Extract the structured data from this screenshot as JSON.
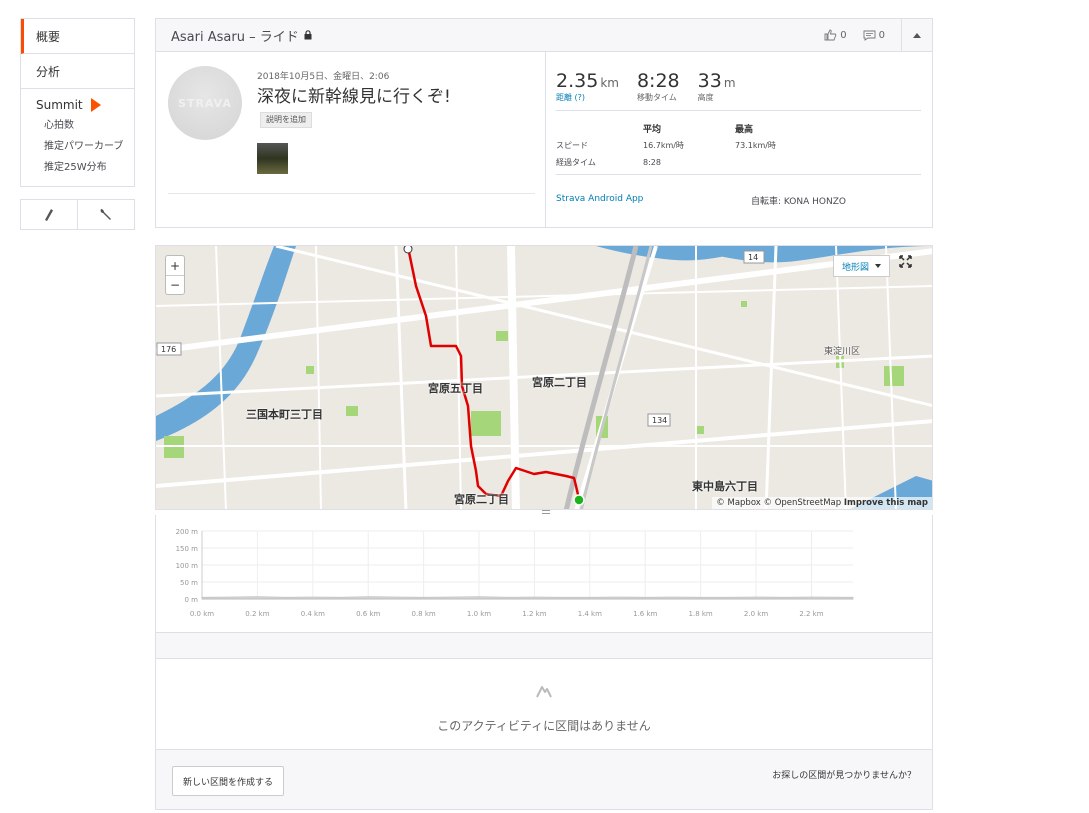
{
  "nav": {
    "overview": "概要",
    "analysis": "分析",
    "summit": "Summit",
    "sub_items": [
      "心拍数",
      "推定パワーカーブ",
      "推定25W分布"
    ]
  },
  "header": {
    "athlete_title": "Asari Asaru – ライド",
    "kudos_count": "0",
    "comment_count": "0"
  },
  "activity": {
    "avatar_text": "STRAVA",
    "date": "2018年10月5日、金曜日、2:06",
    "title": "深夜に新幹線見に行くぞ!",
    "add_description": "説明を追加"
  },
  "stats": {
    "distance": {
      "value": "2.35",
      "unit": "km",
      "label": "距離 (?)"
    },
    "moving_time": {
      "value": "8:28",
      "label": "移動タイム"
    },
    "elevation": {
      "value": "33",
      "unit": "m",
      "label": "高度"
    },
    "table_headers": {
      "avg": "平均",
      "max": "最高"
    },
    "speed": {
      "label": "スピード",
      "avg": "16.7km/時",
      "max": "73.1km/時"
    },
    "elapsed": {
      "label": "経過タイム",
      "avg": "8:28"
    },
    "device": "Strava Android App",
    "bike": "自転車: KONA HONZO"
  },
  "map": {
    "maptype": "地形図",
    "zoom_in": "+",
    "zoom_out": "−",
    "attribution_1": "© Mapbox © OpenStreetMap",
    "attribution_2": "Improve this map",
    "labels": {
      "miyahara5": "宮原五丁目",
      "miyahara2": "宮原二丁目",
      "mikuni": "三国本町三丁目",
      "higashinakajima": "東中島六丁目",
      "miyahara_bottom": "宮原二丁目",
      "higashiyodogawa": "東淀川区",
      "route14": "14",
      "route134": "134",
      "route176": "176"
    }
  },
  "elevation_chart": {
    "y_ticks": [
      "200 m",
      "150 m",
      "100 m",
      "50 m",
      "0 m"
    ],
    "x_ticks": [
      "0.0 km",
      "0.2 km",
      "0.4 km",
      "0.6 km",
      "0.8 km",
      "1.0 km",
      "1.2 km",
      "1.4 km",
      "1.6 km",
      "1.8 km",
      "2.0 km",
      "2.2 km"
    ]
  },
  "chart_data": {
    "type": "area",
    "title": "",
    "xlabel": "",
    "ylabel": "",
    "x": [
      0.0,
      0.1,
      0.2,
      0.3,
      0.4,
      0.5,
      0.6,
      0.7,
      0.8,
      0.9,
      1.0,
      1.1,
      1.2,
      1.3,
      1.4,
      1.5,
      1.6,
      1.7,
      1.8,
      1.9,
      2.0,
      2.1,
      2.2,
      2.35
    ],
    "y": [
      5,
      6,
      7,
      5,
      6,
      5,
      7,
      6,
      5,
      6,
      7,
      5,
      6,
      5,
      5,
      6,
      5,
      6,
      5,
      5,
      6,
      5,
      6,
      5
    ],
    "xlim": [
      0,
      2.35
    ],
    "ylim": [
      0,
      200
    ],
    "grid": true
  },
  "segments": {
    "empty_message": "このアクティビティに区間はありません",
    "new_segment_button": "新しい区間を作成する",
    "find_segment": "お探しの区間が見つかりませんか？"
  },
  "colors": {
    "accent": "#fc4c02",
    "link": "#007fb6",
    "route": "#e00000",
    "water": "#6aa8d8",
    "park": "#a6d67a"
  }
}
